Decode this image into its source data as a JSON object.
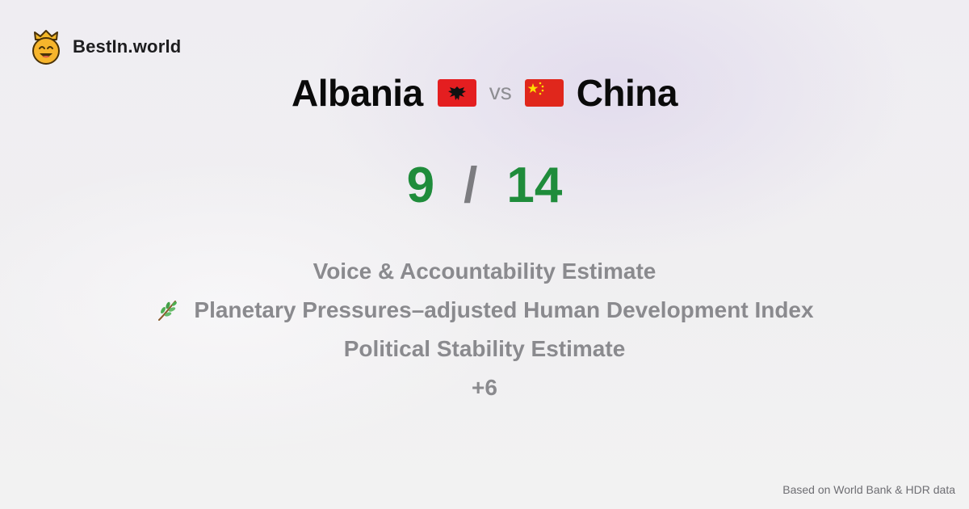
{
  "brand": {
    "name": "BestIn.world",
    "logo_icon": "crown-smiley-icon"
  },
  "comparison": {
    "left": {
      "country": "Albania",
      "flag_icon": "albania-flag-icon",
      "score": "9"
    },
    "vs_label": "vs",
    "right": {
      "country": "China",
      "flag_icon": "china-flag-icon",
      "score": "14"
    },
    "score_separator": "/"
  },
  "metrics": [
    {
      "label": "Voice & Accountability Estimate",
      "icon": ""
    },
    {
      "label": "Planetary Pressures–adjusted Human Development Index",
      "icon": "herb-icon"
    },
    {
      "label": "Political Stability Estimate",
      "icon": ""
    },
    {
      "label": "+6",
      "icon": ""
    }
  ],
  "footer": {
    "source_text": "Based on World Bank & HDR data"
  },
  "colors": {
    "score": "#1f8c3b",
    "muted_text": "#8a8a8e",
    "title_text": "#0a0a0a"
  }
}
